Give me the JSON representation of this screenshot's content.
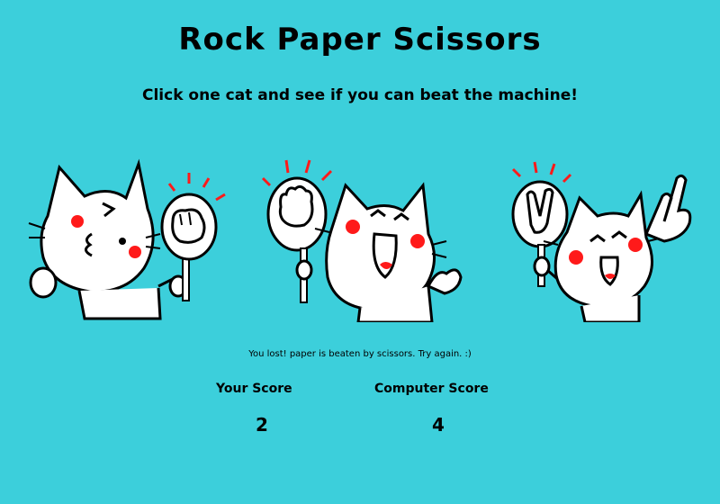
{
  "header": {
    "title": "Rock Paper Scissors",
    "subtitle": "Click one cat and see if you can beat the machine!"
  },
  "choices": [
    {
      "id": "rock",
      "icon": "cat-holding-rock-sign"
    },
    {
      "id": "paper",
      "icon": "cat-holding-paper-sign"
    },
    {
      "id": "scissors",
      "icon": "cat-holding-scissors-sign"
    }
  ],
  "result": {
    "message": "You lost! paper is beaten by scissors. Try again. :)"
  },
  "scores": {
    "player_label": "Your Score",
    "player_value": "2",
    "computer_label": "Computer Score",
    "computer_value": "4"
  },
  "colors": {
    "background": "#3ccfdb",
    "cheek": "#ff1a1a",
    "outline": "#000000"
  }
}
